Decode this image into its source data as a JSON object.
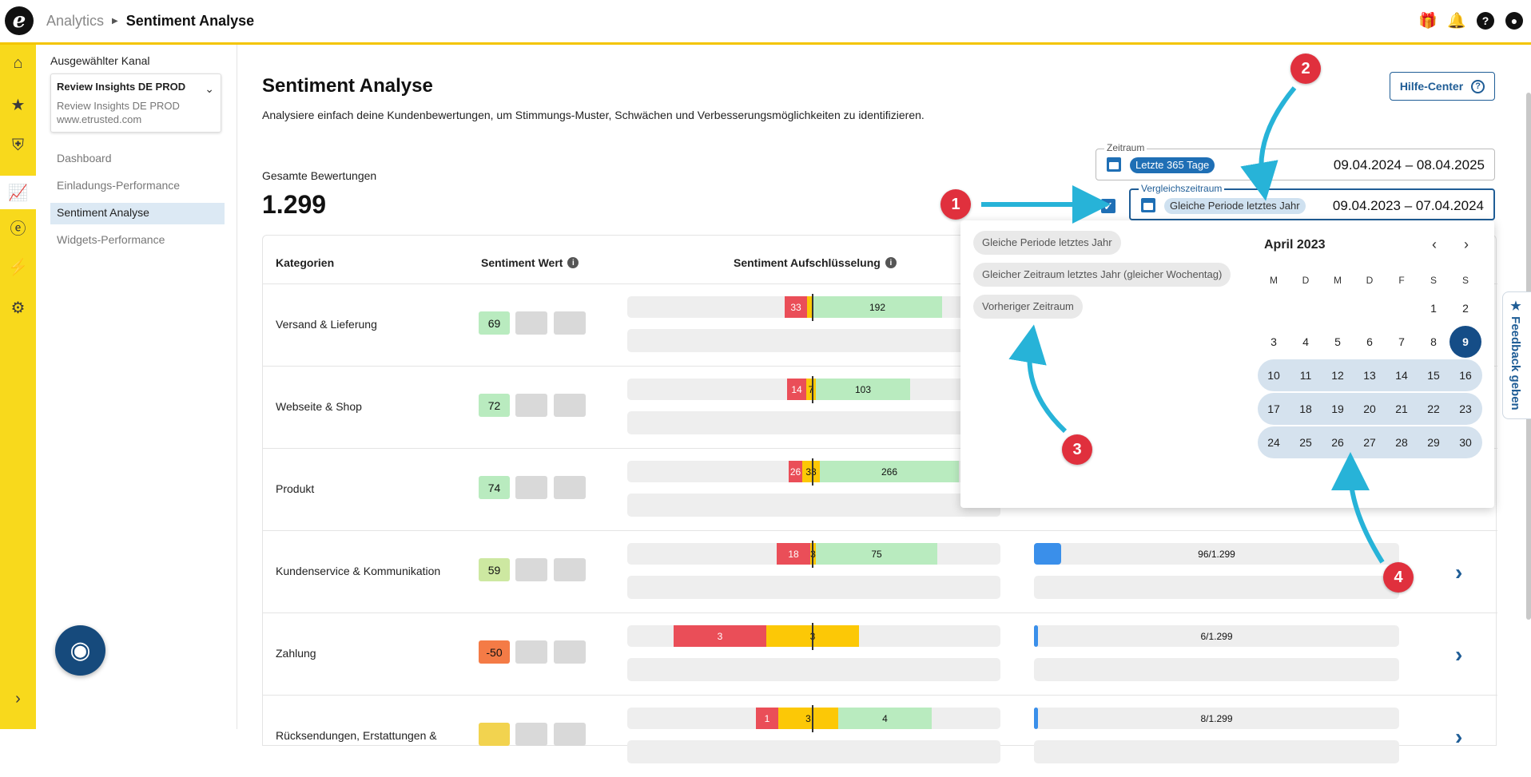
{
  "header": {
    "logo_letter": "e",
    "breadcrumb_parent": "Analytics",
    "breadcrumb_current": "Sentiment Analyse",
    "icons": [
      "gift-icon",
      "bell-icon",
      "help-icon",
      "account-icon"
    ]
  },
  "sidebar": {
    "section_label": "Ausgewählter Kanal",
    "channel_title": "Review Insights DE PROD",
    "channel_name": "Review Insights DE PROD",
    "channel_url": "www.etrusted.com",
    "items": [
      {
        "label": "Dashboard"
      },
      {
        "label": "Einladungs-Performance"
      },
      {
        "label": "Sentiment Analyse"
      },
      {
        "label": "Widgets-Performance"
      }
    ]
  },
  "page": {
    "title": "Sentiment Analyse",
    "subtitle": "Analysiere einfach deine Kundenbewertungen, um Stimmungs-Muster, Schwächen und Verbesserungsmöglichkeiten zu identifizieren.",
    "help_label": "Hilfe-Center",
    "total_label": "Gesamte Bewertungen",
    "total_value": "1.299"
  },
  "filters": {
    "period_label": "Zeitraum",
    "period_chip": "Letzte 365 Tage",
    "period_dates": "09.04.2024 – 08.04.2025",
    "compare_label": "Vergleichszeitraum",
    "compare_chip": "Gleiche Periode letztes Jahr",
    "compare_dates": "09.04.2023 – 07.04.2024",
    "compare_checked": true
  },
  "table": {
    "headers": {
      "category": "Kategorien",
      "score": "Sentiment Wert",
      "breakdown": "Sentiment Aufschlüsselung"
    },
    "rows": [
      {
        "category": "Versand & Lieferung",
        "score": "69",
        "neg": "33",
        "neu": "",
        "pos": "192",
        "count": ""
      },
      {
        "category": "Webseite & Shop",
        "score": "72",
        "neg": "14",
        "neu": "7",
        "pos": "103",
        "count": ""
      },
      {
        "category": "Produkt",
        "score": "74",
        "neg": "26",
        "neu": "33",
        "pos": "266",
        "count": ""
      },
      {
        "category": "Kundenservice & Kommunikation",
        "score": "59",
        "neg": "18",
        "neu": "3",
        "pos": "75",
        "count": "96/1.299"
      },
      {
        "category": "Zahlung",
        "score": "-50",
        "neg": "3",
        "neu": "3",
        "pos": "",
        "count": "6/1.299"
      },
      {
        "category": "Rücksendungen, Erstattungen &",
        "score": "",
        "neg": "1",
        "neu": "3",
        "pos": "4",
        "count": "8/1.299"
      }
    ]
  },
  "picker": {
    "presets": [
      "Gleiche Periode letztes Jahr",
      "Gleicher Zeitraum letztes Jahr (gleicher Wochentag)",
      "Vorheriger Zeitraum"
    ],
    "month": "April 2023",
    "weekdays": [
      "M",
      "D",
      "M",
      "D",
      "F",
      "S",
      "S"
    ],
    "weeks": [
      [
        "",
        "",
        "",
        "",
        "",
        "1",
        "2"
      ],
      [
        "3",
        "4",
        "5",
        "6",
        "7",
        "8",
        "9"
      ],
      [
        "10",
        "11",
        "12",
        "13",
        "14",
        "15",
        "16"
      ],
      [
        "17",
        "18",
        "19",
        "20",
        "21",
        "22",
        "23"
      ],
      [
        "24",
        "25",
        "26",
        "27",
        "28",
        "29",
        "30"
      ]
    ],
    "selected_day": "9"
  },
  "feedback_label": "★ Feedback geben",
  "annotations": [
    "1",
    "2",
    "3",
    "4"
  ],
  "colors": {
    "accent": "#1f5d96",
    "rail": "#f8d91c",
    "negative": "#ea4e58",
    "neutral": "#fcc806",
    "positive": "#b9ebbf",
    "annotation": "#e0303d",
    "arrow": "#27b3d8"
  }
}
